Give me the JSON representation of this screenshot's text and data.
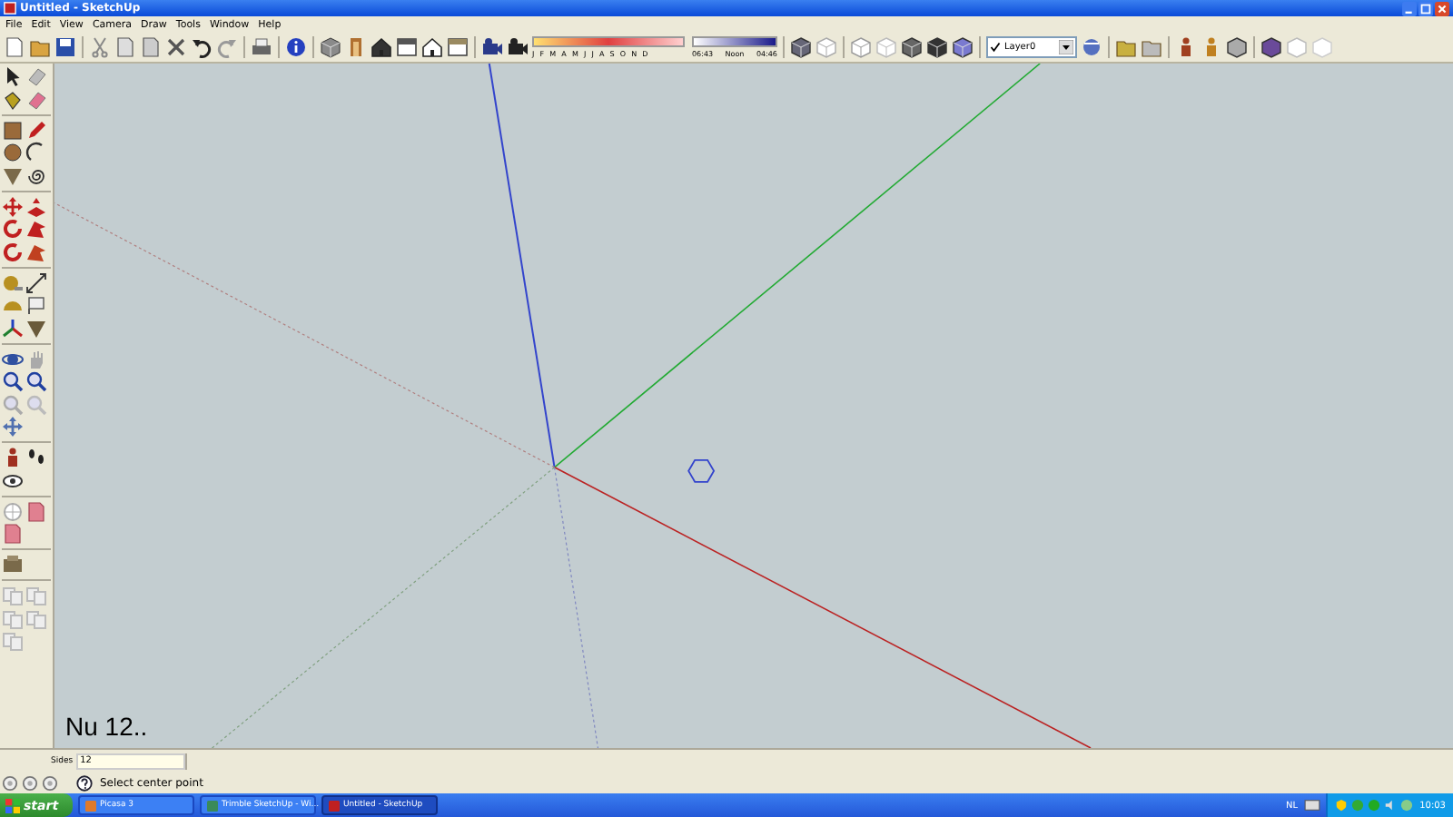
{
  "window": {
    "title": "Untitled - SketchUp"
  },
  "menu": [
    "File",
    "Edit",
    "View",
    "Camera",
    "Draw",
    "Tools",
    "Window",
    "Help"
  ],
  "shadows": {
    "months": "J F M A M J J A S O N D",
    "times": [
      "06:43",
      "Noon",
      "04:46"
    ]
  },
  "layer": {
    "value": "Layer0"
  },
  "canvas": {
    "note": "Nu 12.."
  },
  "measurements": {
    "label": "Sides",
    "value": "12"
  },
  "status_bar": {
    "message": "Select center point"
  },
  "taskbar": {
    "start": "start",
    "items": [
      {
        "label": "Picasa 3",
        "selected": false
      },
      {
        "label": "Trimble SketchUp - Wi...",
        "selected": false
      },
      {
        "label": "Untitled - SketchUp",
        "selected": true
      }
    ],
    "language": "NL",
    "clock": "10:03"
  }
}
